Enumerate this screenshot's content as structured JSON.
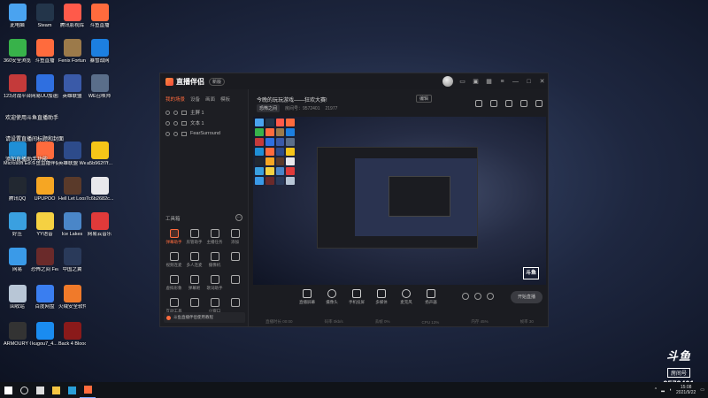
{
  "desktop": {
    "icons": [
      {
        "label": "此电脑",
        "color": "#4aa3f0"
      },
      {
        "label": "Steam",
        "color": "#23354a"
      },
      {
        "label": "腾讯影视库",
        "color": "#ff5a4a"
      },
      {
        "label": "斗鱼直播",
        "color": "#ff6b3d"
      },
      {
        "label": "360安全浏览器",
        "color": "#38b24a"
      },
      {
        "label": "斗鱼直播",
        "color": "#ff6b3d"
      },
      {
        "label": "Fenix Fortune -...",
        "color": "#9c7a4a"
      },
      {
        "label": "暴雪战网",
        "color": "#1c7fe0"
      },
      {
        "label": "123对战平台",
        "color": "#c43a3a"
      },
      {
        "label": "网易UU加速器",
        "color": "#2f6fe0"
      },
      {
        "label": "英雄联盟",
        "color": "#3a5aa8"
      },
      {
        "label": "WE召唤师",
        "color": "#5a6e8a"
      },
      {
        "label": "Microsoft Edge",
        "color": "#1f8fd6"
      },
      {
        "label": "斗鱼直播伴侣",
        "color": "#ff6b3d"
      },
      {
        "label": "英雄联盟 WeGame版",
        "color": "#2d4b8a"
      },
      {
        "label": "a5b962f7f...",
        "color": "#f5c518"
      },
      {
        "label": "腾讯QQ",
        "color": "#222831"
      },
      {
        "label": "UPUPOO",
        "color": "#f6a623"
      },
      {
        "label": "Hell Let Loose",
        "color": "#5a3a2a"
      },
      {
        "label": "7c6b2682c...",
        "color": "#e8e8ec"
      },
      {
        "label": "好压",
        "color": "#3aa0e0"
      },
      {
        "label": "YY语音",
        "color": "#f5d142"
      },
      {
        "label": "Ice Lakes",
        "color": "#4a86c8"
      },
      {
        "label": "网易云音乐",
        "color": "#e03a3a"
      },
      {
        "label": "网易",
        "color": "#3a9ae8"
      },
      {
        "label": "恐怖之间 Fear surr...",
        "color": "#6a2a2a"
      },
      {
        "label": "中国之翼",
        "color": "#2a3a5a"
      },
      {
        "label": "回收站",
        "color": "#b8c6d6"
      },
      {
        "label": "百度网盘",
        "color": "#3a7ef0"
      },
      {
        "label": "火绒安全软件",
        "color": "#f07a2a"
      },
      {
        "label": "ARMOURY CRATE",
        "color": "#333"
      },
      {
        "label": "kugou7_4...",
        "color": "#1a8cf0"
      },
      {
        "label": "Back 4 Blood Beta",
        "color": "#8a1a1a"
      }
    ],
    "notes": [
      "欢迎使用斗鱼直播助手",
      "请设置直播间标题和封面",
      "添加直播助手功能"
    ]
  },
  "app": {
    "logo": "直播伴侣",
    "version": "新版",
    "left_tabs": [
      "我的场景",
      "设备",
      "画面",
      "模板"
    ],
    "sources": [
      {
        "name": "主屏 1"
      },
      {
        "name": "文本 1"
      },
      {
        "name": "FearSurround"
      }
    ],
    "tools_title": "工具箱",
    "tools_more": "···",
    "tools": [
      {
        "label": "弹幕助手",
        "hot": true
      },
      {
        "label": "房管助手",
        "hot": false
      },
      {
        "label": "主播任务",
        "hot": false
      },
      {
        "label": "添加",
        "hot": false
      },
      {
        "label": "视频连麦",
        "hot": false
      },
      {
        "label": "多人连麦",
        "hot": false
      },
      {
        "label": "摄像机",
        "hot": false
      },
      {
        "label": "",
        "hot": false
      },
      {
        "label": "虚拟形象",
        "hot": false
      },
      {
        "label": "弹幕姬",
        "hot": false
      },
      {
        "label": "歌词助手",
        "hot": false
      },
      {
        "label": "",
        "hot": false
      },
      {
        "label": "互动工具",
        "hot": false
      },
      {
        "label": "",
        "hot": false
      },
      {
        "label": "小窗口",
        "hot": false
      },
      {
        "label": "",
        "hot": false
      }
    ],
    "notice": "斗鱼直播伴侣使用教程",
    "room": {
      "title": "今晚的玩玩游戏——狂欢大赛!",
      "edit": "编辑",
      "category": "恐怖之间",
      "room_label": "房间号：9572401",
      "heat": "21977"
    },
    "controls": [
      "直播屏幕",
      "摄像头",
      "手机投屏",
      "多媒体",
      "麦克风",
      "扬声器"
    ],
    "live_button": "开始直播",
    "status": [
      "直播时长 00:00",
      "码率 0kb/s",
      "丢帧 0%",
      "CPU 13%",
      "内存 45%",
      "帧率 30"
    ],
    "preview_badge": "斗鱼"
  },
  "overlay": {
    "logo": "斗鱼",
    "sub": "房间号",
    "room": "9572401"
  },
  "taskbar": {
    "apps": [
      {
        "name": "start",
        "color": "#ffffff"
      },
      {
        "name": "search",
        "color": "#dddddd"
      },
      {
        "name": "task-view",
        "color": "#dddddd"
      },
      {
        "name": "file-explorer",
        "color": "#f5c542"
      },
      {
        "name": "edge",
        "color": "#2a9fd8"
      },
      {
        "name": "douyu",
        "color": "#ff6b3d"
      }
    ],
    "time": "15:08",
    "date": "2021/9/22"
  }
}
